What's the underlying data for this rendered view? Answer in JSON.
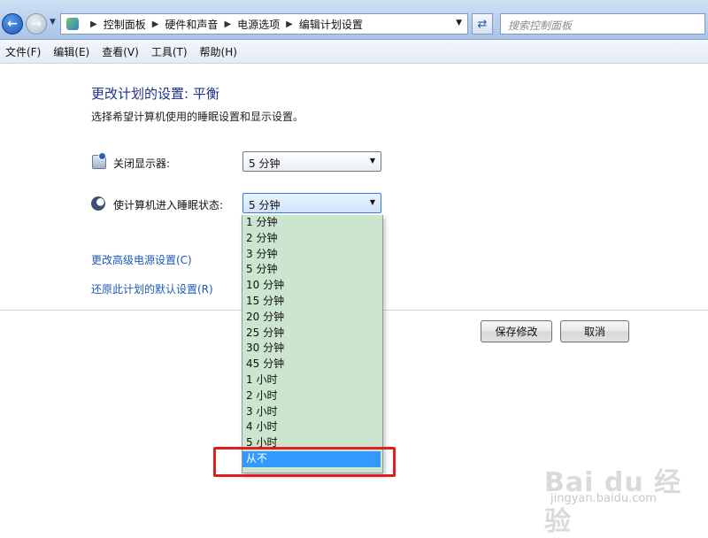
{
  "toolbar": {
    "breadcrumbs": [
      "控制面板",
      "硬件和声音",
      "电源选项",
      "编辑计划设置"
    ],
    "search_placeholder": "搜索控制面板"
  },
  "menu": [
    "文件(F)",
    "编辑(E)",
    "查看(V)",
    "工具(T)",
    "帮助(H)"
  ],
  "main": {
    "title": "更改计划的设置: 平衡",
    "description": "选择希望计算机使用的睡眠设置和显示设置。",
    "display_label": "关闭显示器:",
    "display_value": "5 分钟",
    "sleep_label": "使计算机进入睡眠状态:",
    "sleep_value": "5 分钟",
    "links": {
      "advanced": "更改高级电源设置(C)",
      "reset": "还原此计划的默认设置(R)"
    },
    "save_label": "保存修改",
    "cancel_label": "取消"
  },
  "dropdown": {
    "options": [
      "1 分钟",
      "2 分钟",
      "3 分钟",
      "5 分钟",
      "10 分钟",
      "15 分钟",
      "20 分钟",
      "25 分钟",
      "30 分钟",
      "45 分钟",
      "1 小时",
      "2 小时",
      "3 小时",
      "4 小时",
      "5 小时",
      "从不"
    ],
    "highlighted_option": "从不"
  },
  "watermark": {
    "brand": "Bai du 经验",
    "url": "jingyan.baidu.com"
  },
  "colors": {
    "dropdown_bg": "#cbe5cf",
    "selection": "#3399ff",
    "annotation": "#e01f1f",
    "title": "#1e3287",
    "link": "#1e58b8"
  }
}
